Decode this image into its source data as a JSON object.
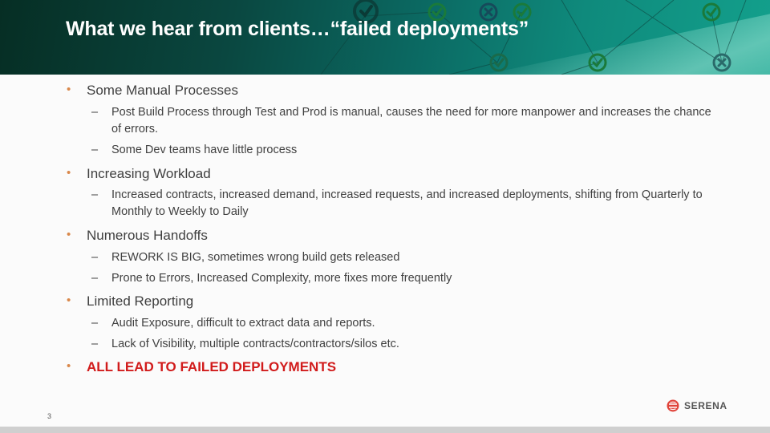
{
  "slide": {
    "title": "What we hear from clients…“failed deployments”",
    "page_number": "3",
    "logo_text": "SERENA",
    "colors": {
      "header_dark": "#062e24",
      "header_light": "#13a08c",
      "bullet": "#d9884a",
      "emphasis": "#d11b1b",
      "logo_red": "#e0433a"
    },
    "header_icons": [
      {
        "type": "check-icon"
      },
      {
        "type": "check-icon"
      },
      {
        "type": "x-icon"
      },
      {
        "type": "check-icon"
      },
      {
        "type": "check-icon"
      },
      {
        "type": "check-icon"
      },
      {
        "type": "check-icon"
      },
      {
        "type": "x-icon"
      }
    ],
    "bullets": [
      {
        "text": "Some Manual Processes",
        "subs": [
          "Post Build Process through Test and Prod is manual, causes the need for more manpower and increases the chance of errors.",
          "Some Dev teams have little process"
        ]
      },
      {
        "text": "Increasing Workload",
        "subs": [
          "Increased contracts, increased demand, increased requests, and increased deployments, shifting from Quarterly to Monthly to Weekly to Daily"
        ]
      },
      {
        "text": "Numerous Handoffs",
        "subs": [
          "REWORK IS BIG, sometimes wrong build gets released",
          "Prone to Errors, Increased Complexity, more fixes more frequently"
        ]
      },
      {
        "text": "Limited Reporting",
        "subs": [
          "Audit Exposure, difficult to extract data and reports.",
          "Lack of Visibility, multiple contracts/contractors/silos etc."
        ]
      },
      {
        "text": "ALL LEAD TO FAILED DEPLOYMENTS",
        "subs": []
      }
    ]
  }
}
